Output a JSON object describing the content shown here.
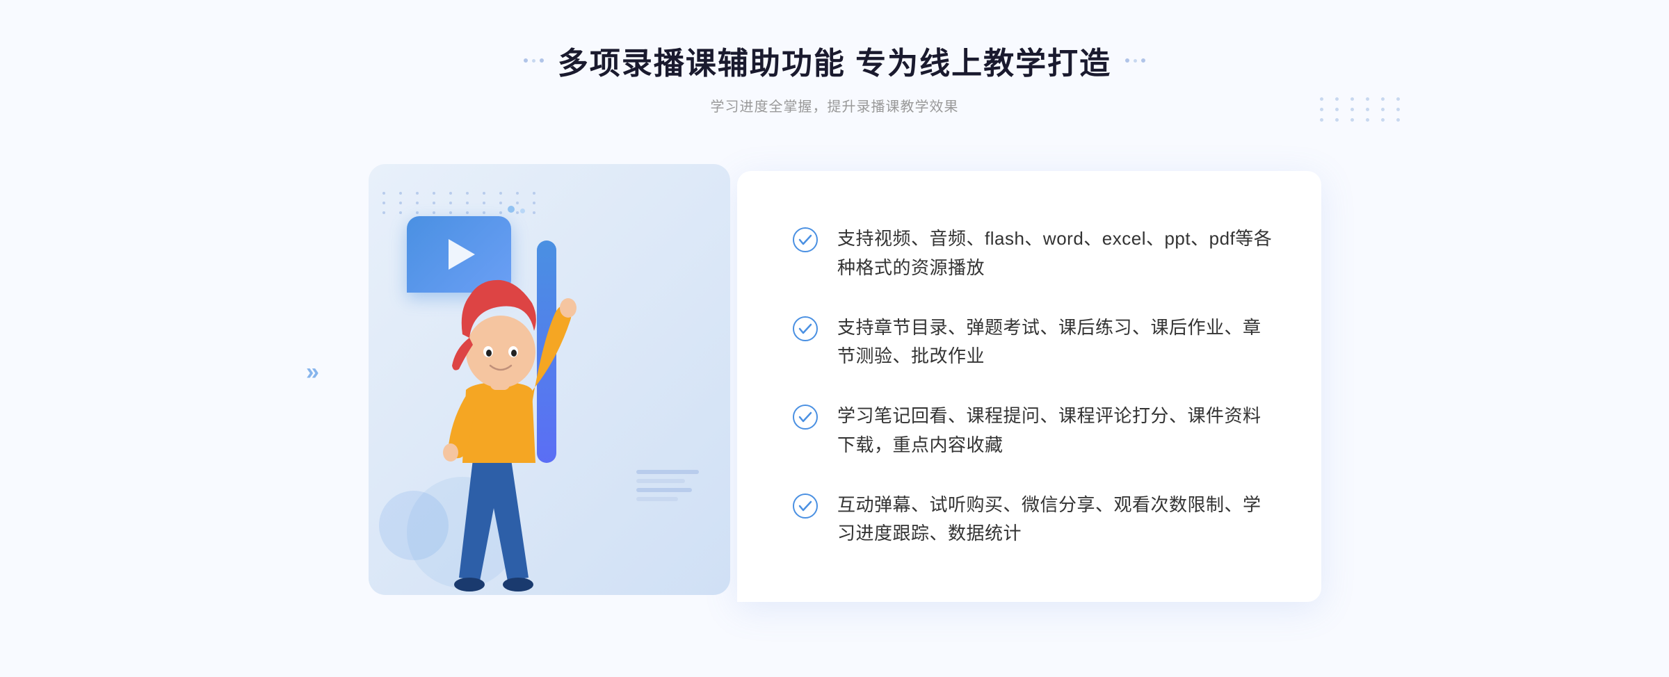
{
  "header": {
    "title": "多项录播课辅助功能 专为线上教学打造",
    "subtitle": "学习进度全掌握，提升录播课教学效果",
    "title_dots_label": "decorative dots"
  },
  "features": [
    {
      "id": 1,
      "text": "支持视频、音频、flash、word、excel、ppt、pdf等各种格式的资源播放"
    },
    {
      "id": 2,
      "text": "支持章节目录、弹题考试、课后练习、课后作业、章节测验、批改作业"
    },
    {
      "id": 3,
      "text": "学习笔记回看、课程提问、课程评论打分、课件资料下载，重点内容收藏"
    },
    {
      "id": 4,
      "text": "互动弹幕、试听购买、微信分享、观看次数限制、学习进度跟踪、数据统计"
    }
  ],
  "colors": {
    "primary": "#4a90e2",
    "title": "#1a1a2e",
    "text": "#333333",
    "subtitle": "#999999",
    "check": "#4a90e2",
    "bg": "#f8faff"
  },
  "icons": {
    "check": "check-circle",
    "play": "play-button",
    "chevron": "chevron-right"
  }
}
